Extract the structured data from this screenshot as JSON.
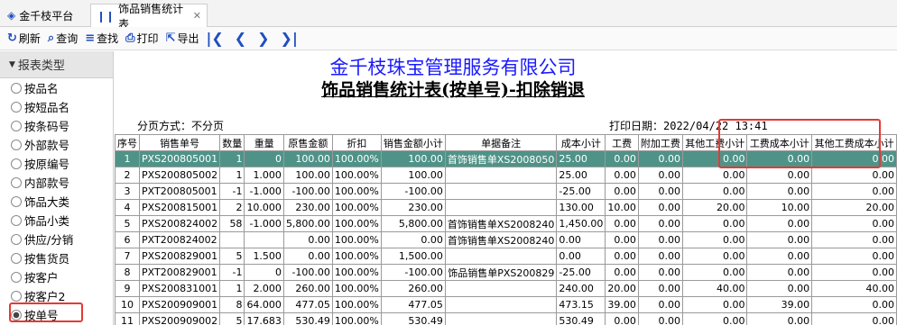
{
  "tabs": [
    {
      "label": "金千枝平台"
    },
    {
      "label": "饰品销售统计表"
    }
  ],
  "toolbar": {
    "refresh": "刷新",
    "query": "查询",
    "find": "查找",
    "print": "打印",
    "export": "导出"
  },
  "left_panel": {
    "header": "报表类型",
    "items": [
      {
        "label": "按品名"
      },
      {
        "label": "按短品名"
      },
      {
        "label": "按条码号"
      },
      {
        "label": "外部款号"
      },
      {
        "label": "按原编号"
      },
      {
        "label": "内部款号"
      },
      {
        "label": "饰品大类"
      },
      {
        "label": "饰品小类"
      },
      {
        "label": "供应/分销"
      },
      {
        "label": "按售货员"
      },
      {
        "label": "按客户"
      },
      {
        "label": "按客户2"
      },
      {
        "label": "按单号"
      }
    ],
    "selected": "按单号"
  },
  "report": {
    "company": "金千枝珠宝管理服务有限公司",
    "title": "饰品销售统计表(按单号)-扣除销退",
    "page_mode": "分页方式：不分页",
    "print_date": "打印日期：2022/04/22 13:41",
    "columns": [
      "序号",
      "销售单号",
      "数量",
      "重量",
      "原售金额",
      "折扣",
      "销售金额小计",
      "单据备注",
      "成本小计",
      "工费",
      "附加工费",
      "其他工费小计",
      "工费成本小计",
      "其他工费成本小计"
    ],
    "rows": [
      {
        "cells": [
          "1",
          "PXS200805001",
          "1",
          "0",
          "100.00",
          "100.00%",
          "100.00",
          "首饰销售单XS2008050",
          "25.00",
          "0.00",
          "0.00",
          "0.00",
          "0.00",
          "0.00"
        ],
        "selected": true
      },
      {
        "cells": [
          "2",
          "PXS200805002",
          "1",
          "1.000",
          "100.00",
          "100.00%",
          "100.00",
          "",
          "25.00",
          "0.00",
          "0.00",
          "0.00",
          "0.00",
          "0.00"
        ]
      },
      {
        "cells": [
          "3",
          "PXT200805001",
          "-1",
          "-1.000",
          "-100.00",
          "100.00%",
          "-100.00",
          "",
          "-25.00",
          "0.00",
          "0.00",
          "0.00",
          "0.00",
          "0.00"
        ]
      },
      {
        "cells": [
          "4",
          "PXS200815001",
          "2",
          "10.000",
          "230.00",
          "100.00%",
          "230.00",
          "",
          "130.00",
          "10.00",
          "0.00",
          "20.00",
          "10.00",
          "20.00"
        ]
      },
      {
        "cells": [
          "5",
          "PXS200824002",
          "58",
          "-1.000",
          "5,800.00",
          "100.00%",
          "5,800.00",
          "首饰销售单XS2008240",
          "1,450.00",
          "0.00",
          "0.00",
          "0.00",
          "0.00",
          "0.00"
        ]
      },
      {
        "cells": [
          "6",
          "PXT200824002",
          "",
          "",
          "0.00",
          "100.00%",
          "0.00",
          "首饰销售单XS2008240",
          "0.00",
          "0.00",
          "0.00",
          "0.00",
          "0.00",
          "0.00"
        ]
      },
      {
        "cells": [
          "7",
          "PXS200829001",
          "5",
          "1.500",
          "0.00",
          "100.00%",
          "1,500.00",
          "",
          "0.00",
          "0.00",
          "0.00",
          "0.00",
          "0.00",
          "0.00"
        ]
      },
      {
        "cells": [
          "8",
          "PXT200829001",
          "-1",
          "0",
          "-100.00",
          "100.00%",
          "-100.00",
          "饰品销售单PXS200829",
          "-25.00",
          "0.00",
          "0.00",
          "0.00",
          "0.00",
          "0.00"
        ]
      },
      {
        "cells": [
          "9",
          "PXS200831001",
          "1",
          "2.000",
          "260.00",
          "100.00%",
          "260.00",
          "",
          "240.00",
          "20.00",
          "0.00",
          "40.00",
          "0.00",
          "40.00"
        ]
      },
      {
        "cells": [
          "10",
          "PXS200909001",
          "8",
          "64.000",
          "477.05",
          "100.00%",
          "477.05",
          "",
          "473.15",
          "39.00",
          "0.00",
          "0.00",
          "39.00",
          "0.00"
        ]
      },
      {
        "cells": [
          "11",
          "PXS200909002",
          "5",
          "17.683",
          "530.49",
          "100.00%",
          "530.49",
          "",
          "530.49",
          "0.00",
          "0.00",
          "0.00",
          "0.00",
          "0.00"
        ]
      }
    ]
  }
}
